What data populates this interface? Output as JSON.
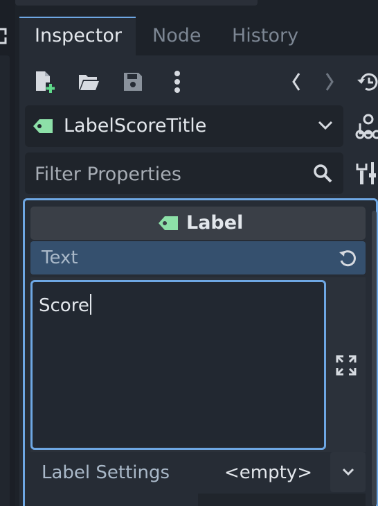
{
  "tabs": [
    {
      "label": "Inspector",
      "active": true
    },
    {
      "label": "Node",
      "active": false
    },
    {
      "label": "History",
      "active": false
    }
  ],
  "toolbar": {
    "icons": [
      "new-resource-icon",
      "open-folder-icon",
      "save-icon",
      "more-vertical-icon",
      "history-back-icon",
      "history-forward-icon",
      "object-history-icon"
    ]
  },
  "object_selector": {
    "name": "LabelScoreTitle",
    "icon": "label-tag-icon"
  },
  "filter": {
    "placeholder": "Filter Properties",
    "value": ""
  },
  "section": {
    "class_name": "Label",
    "properties": {
      "text": {
        "label": "Text",
        "value": "Score"
      },
      "label_settings": {
        "label": "Label Settings",
        "value": "<empty>"
      }
    }
  },
  "colors": {
    "accent": "#6ea7e3",
    "tag_green": "#8de0a8",
    "panel_bg": "#262c35",
    "selected_prop_bg": "#35506e"
  }
}
